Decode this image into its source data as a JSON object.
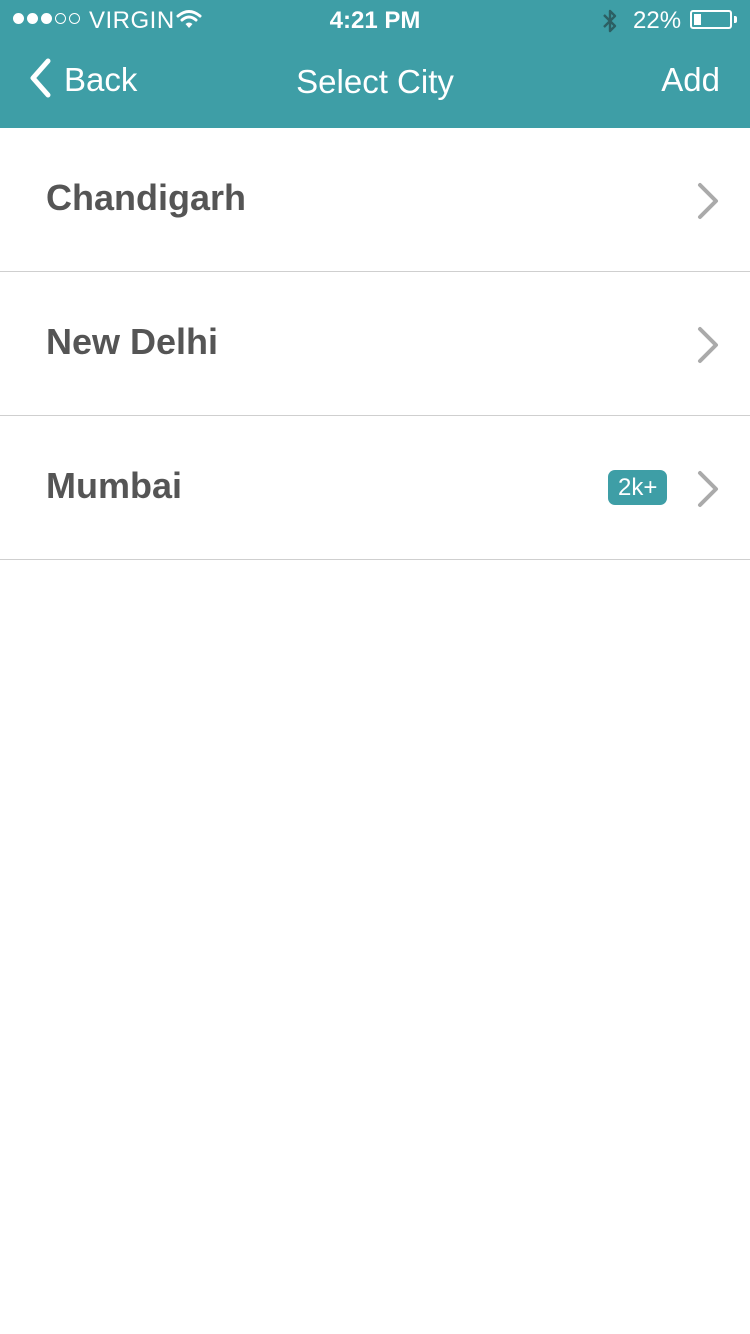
{
  "status_bar": {
    "signal_bars_filled": 3,
    "signal_bars_total": 5,
    "carrier": "VIRGIN",
    "time": "4:21 PM",
    "battery_text": "22%",
    "battery_level": 0.22,
    "icons": [
      "wifi-icon",
      "bluetooth-icon",
      "battery-icon"
    ]
  },
  "nav": {
    "back_label": "Back",
    "title": "Select City",
    "add_label": "Add"
  },
  "cities": [
    {
      "name": "Chandigarh",
      "badge": ""
    },
    {
      "name": "New Delhi",
      "badge": ""
    },
    {
      "name": "Mumbai",
      "badge": "2k+"
    }
  ],
  "colors": {
    "accent": "#3e9ea6",
    "row_text": "#555555",
    "chevron": "#aaaaaa",
    "divider": "#cfcfcf"
  }
}
